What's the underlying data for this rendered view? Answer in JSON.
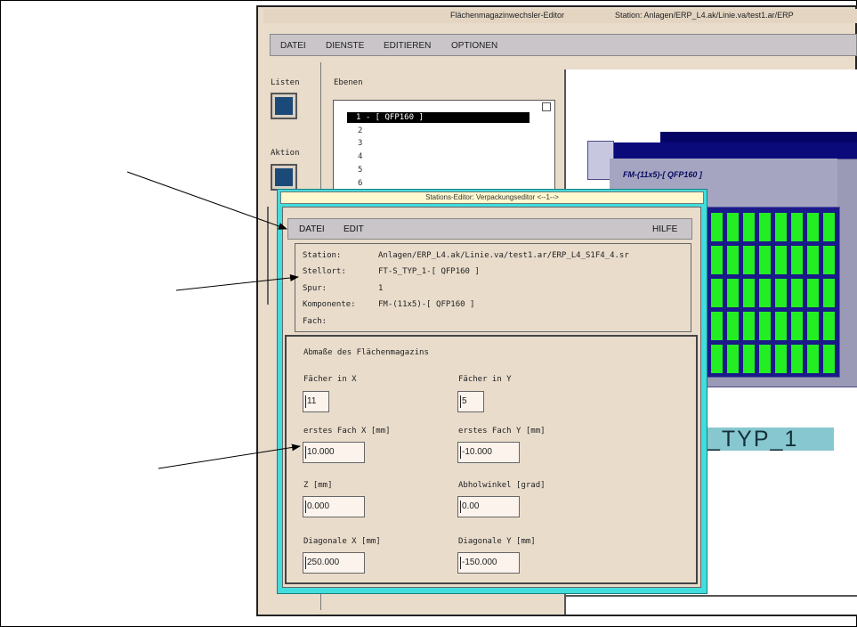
{
  "background_window": {
    "title_left": "Flächenmagazinwechsler-Editor",
    "title_right": "Station:  Anlagen/ERP_L4.ak/Linie.va/test1.ar/ERP",
    "menu": [
      "DATEI",
      "DIENSTE",
      "EDITIEREN",
      "OPTIONEN"
    ],
    "left_labels": {
      "listen": "Listen",
      "aktion": "Aktion"
    },
    "ebenen_label": "Ebenen",
    "levels": [
      "1 - [ QFP160 ]",
      "2",
      "3",
      "4",
      "5",
      "6"
    ],
    "fm_label": "FM-(11x5)-[ QFP160 ]",
    "typ_label": "_TYP_1"
  },
  "dialog": {
    "title": "Stations-Editor: Verpackungseditor <--1-->",
    "menu": {
      "datei": "DATEI",
      "edit": "EDIT",
      "hilfe": "HILFE"
    },
    "info": [
      {
        "label": "Station:",
        "value": "Anlagen/ERP_L4.ak/Linie.va/test1.ar/ERP_L4_S1F4_4.sr"
      },
      {
        "label": "Stellort:",
        "value": "FT-S_TYP_1-[ QFP160 ]"
      },
      {
        "label": "Spur:",
        "value": "1"
      },
      {
        "label": "Komponente:",
        "value": "FM-(11x5)-[ QFP160 ]"
      },
      {
        "label": "Fach:",
        "value": ""
      }
    ],
    "form": {
      "title": "Abmaße des Flächenmagazins",
      "faecher_x": {
        "label": "Fächer in X",
        "value": "11"
      },
      "faecher_y": {
        "label": "Fächer in Y",
        "value": "5"
      },
      "erstes_x": {
        "label": "erstes Fach X [mm]",
        "value": "10.000"
      },
      "erstes_y": {
        "label": "erstes Fach Y [mm]",
        "value": "-10.000"
      },
      "z": {
        "label": "Z [mm]",
        "value": "0.000"
      },
      "abholwinkel": {
        "label": "Abholwinkel [grad]",
        "value": "0.00"
      },
      "diag_x": {
        "label": "Diagonale X [mm]",
        "value": "250.000"
      },
      "diag_y": {
        "label": "Diagonale Y [mm]",
        "value": "-150.000"
      }
    }
  },
  "colors": {
    "dialog_border": "#42dddd",
    "window_bg": "#e9dccb",
    "cell_green": "#22ee22",
    "magazine_blue": "#1a1a8a"
  }
}
